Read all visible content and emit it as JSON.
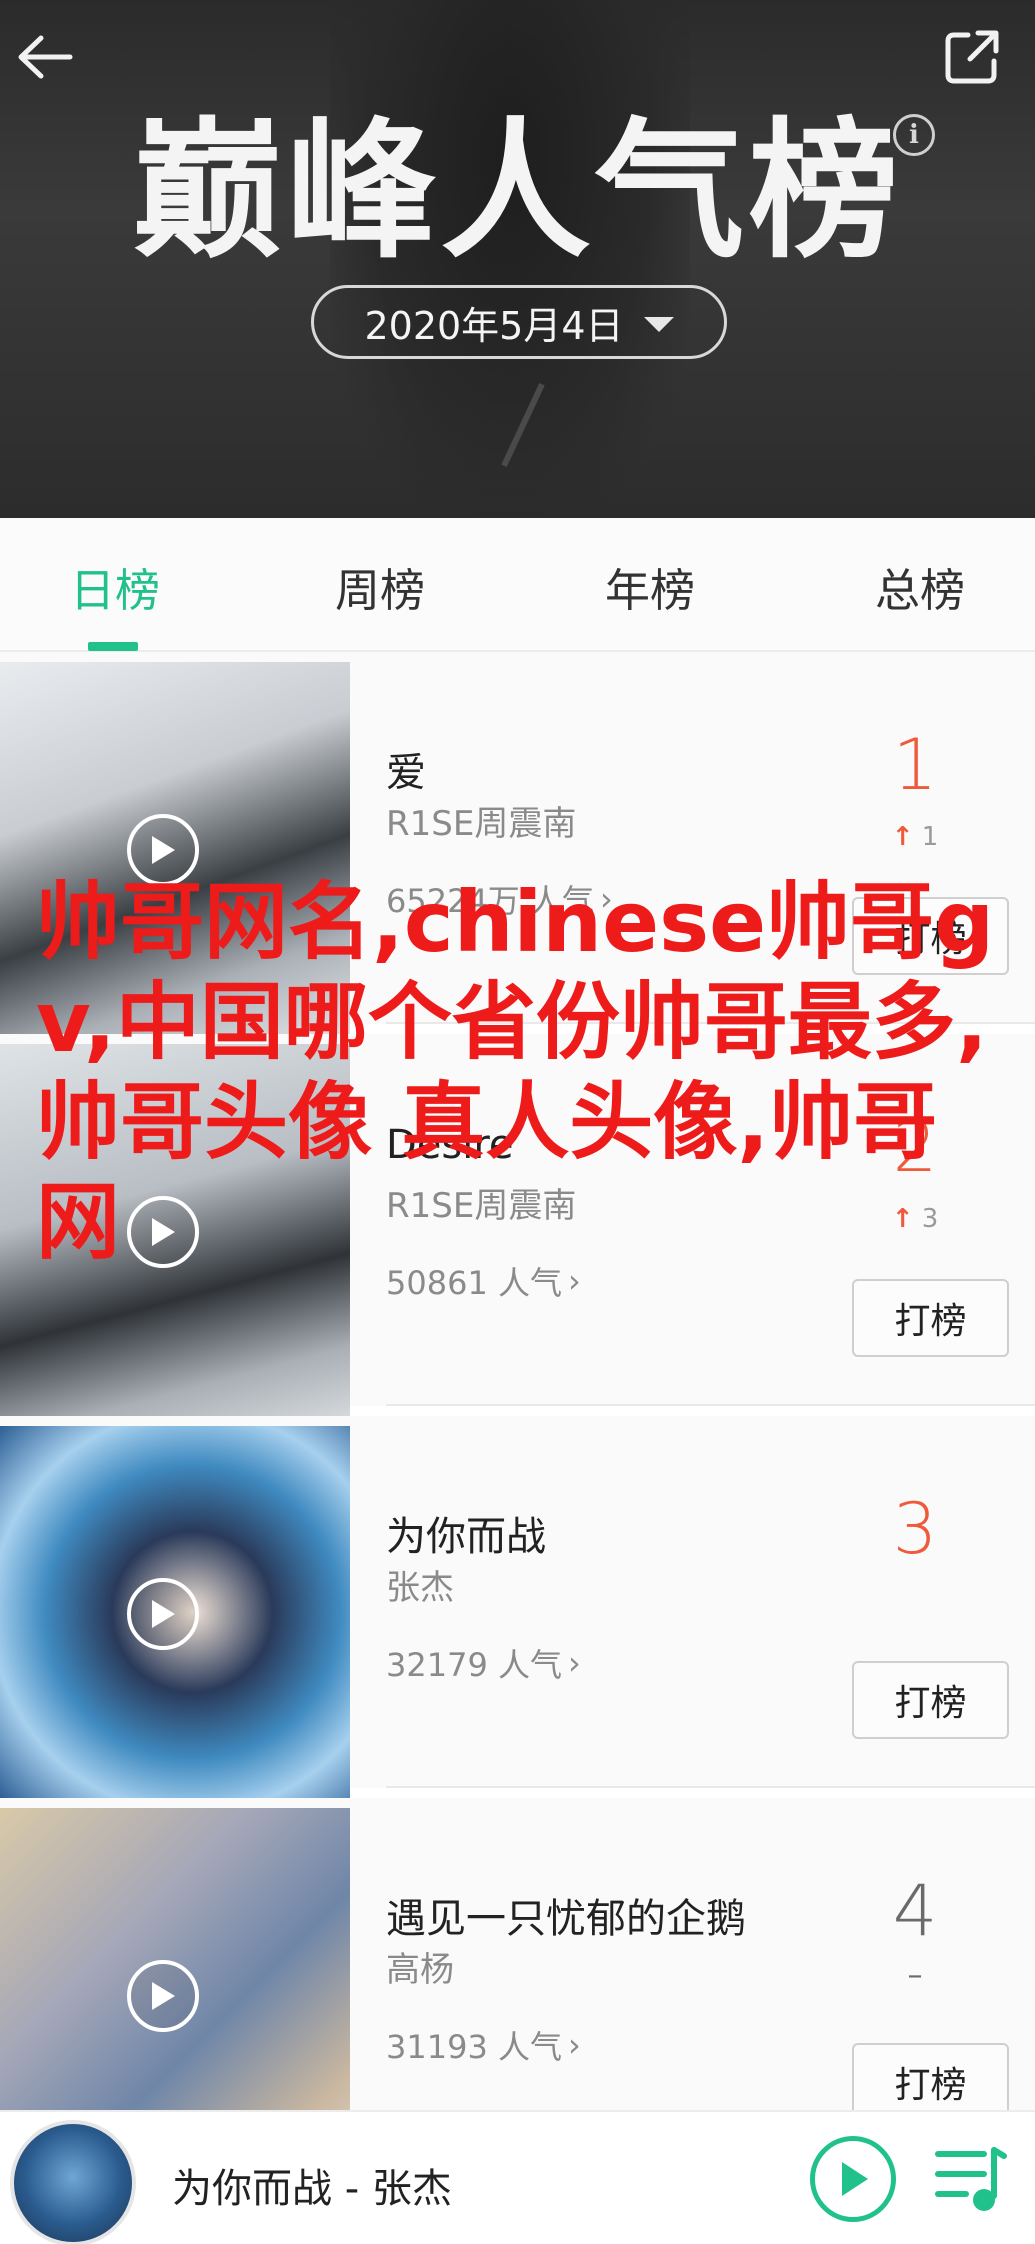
{
  "header": {
    "title": "巅峰人气榜",
    "date": "2020年5月4日",
    "back_icon": "back-arrow-icon",
    "share_icon": "share-icon",
    "info_icon": "info-icon",
    "info_glyph": "i"
  },
  "tabs": [
    {
      "label": "日榜",
      "active": true
    },
    {
      "label": "周榜",
      "active": false
    },
    {
      "label": "年榜",
      "active": false
    },
    {
      "label": "总榜",
      "active": false
    }
  ],
  "songs": [
    {
      "title": "爱",
      "artist": "R1SE周震南",
      "popularity": "65224万 人气",
      "rank": "1",
      "trend": "1",
      "trend_dir": "up",
      "vote": "打榜"
    },
    {
      "title": "Desire",
      "artist": "R1SE周震南",
      "popularity": "50861 人气",
      "rank": "2",
      "trend": "3",
      "trend_dir": "up",
      "vote": "打榜"
    },
    {
      "title": "为你而战",
      "artist": "张杰",
      "popularity": "32179 人气",
      "rank": "3",
      "trend": "",
      "trend_dir": "none",
      "vote": "打榜"
    },
    {
      "title": "遇见一只忧郁的企鹅",
      "artist": "高杨",
      "popularity": "31193 人气",
      "rank": "4",
      "trend": "–",
      "trend_dir": "same",
      "vote": "打榜"
    }
  ],
  "overlay_text": "帅哥网名,chinese帅哥gv,中国哪个省份帅哥最多,帅哥头像 真人头像,帅哥网",
  "player": {
    "now_playing": "为你而战 - 张杰",
    "play_icon": "play-icon",
    "playlist_icon": "playlist-icon"
  },
  "colors": {
    "accent": "#21c18b",
    "rank_red": "#ef5a3a",
    "overlay_red": "#ee1b1b"
  }
}
